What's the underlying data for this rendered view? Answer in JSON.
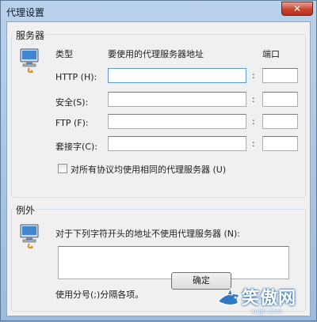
{
  "window": {
    "title": "代理设置",
    "close_glyph": "✕"
  },
  "servers": {
    "legend": "服务器",
    "icon": "proxy-computer-icon",
    "headers": {
      "type": "类型",
      "address": "要使用的代理服务器地址",
      "port": "端口"
    },
    "rows": [
      {
        "label": "HTTP (H):",
        "address": "",
        "port": ""
      },
      {
        "label": "安全(S):",
        "address": "",
        "port": ""
      },
      {
        "label": "FTP (F):",
        "address": "",
        "port": ""
      },
      {
        "label": "套接字(C):",
        "address": "",
        "port": ""
      }
    ],
    "same_proxy_label": "对所有协议均使用相同的代理服务器 (U)",
    "same_proxy_checked": false
  },
  "exceptions": {
    "legend": "例外",
    "icon": "exceptions-computer-icon",
    "description": "对于下列字符开头的地址不使用代理服务器 (N):",
    "value": "",
    "hint": "使用分号(;)分隔各项。"
  },
  "buttons": {
    "ok": "确定"
  },
  "watermark": {
    "text": "笑傲网",
    "url": "xajjn.com"
  },
  "colors": {
    "accent": "#5b9bd5",
    "close": "#c7442f"
  }
}
